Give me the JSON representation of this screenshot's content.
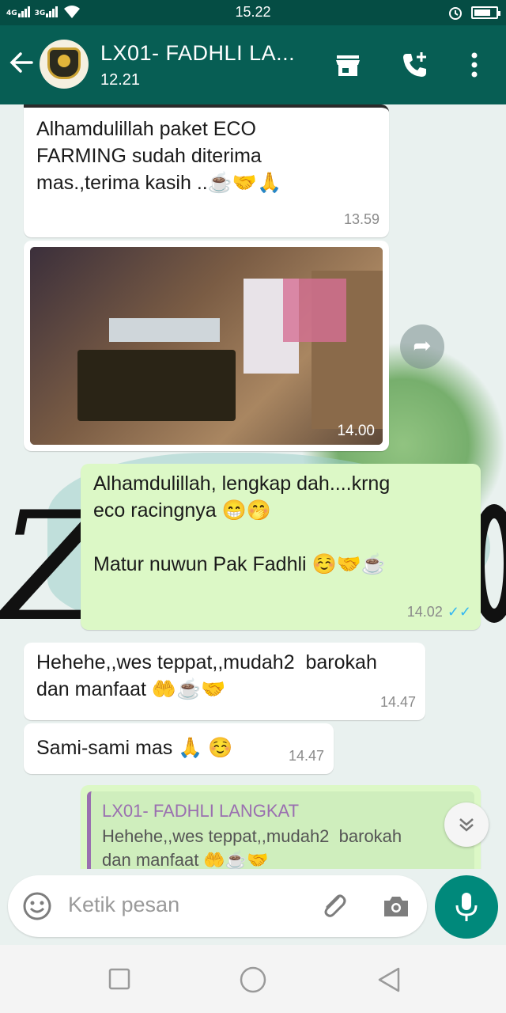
{
  "status_bar": {
    "time": "15.22",
    "network_left": "4G",
    "network_right": "3G",
    "icons": [
      "signal-icon",
      "wifi-icon",
      "alarm-icon",
      "battery-icon"
    ]
  },
  "header": {
    "contact_name": "LX01- FADHLI LA...",
    "last_seen": "12.21",
    "icons": [
      "back-arrow-icon",
      "store-icon",
      "add-call-icon",
      "more-vert-icon"
    ],
    "colors": {
      "bar": "#075e54",
      "status_bar": "#054d44"
    }
  },
  "messages": [
    {
      "id": "m1",
      "direction": "in",
      "text": "Alhamdulillah paket ECO\nFARMING sudah diterima\nmas.,terima kasih ..☕🤝🙏",
      "time": "13.59"
    },
    {
      "id": "m2",
      "direction": "in",
      "type": "photo",
      "time": "14.00"
    },
    {
      "id": "m3",
      "direction": "out",
      "text": "Alhamdulillah, lengkap dah....krng\neco racingnya 😁🤭\n\nMatur nuwun Pak Fadhli ☺️🤝☕",
      "time": "14.02",
      "read_ticks": "✓✓"
    },
    {
      "id": "m4",
      "direction": "in",
      "text": "Hehehe,,wes teppat,,mudah2  barokah\ndan manfaat 🤲☕🤝",
      "time": "14.47"
    },
    {
      "id": "m5",
      "direction": "in",
      "text": "Sami-sami mas 🙏 ☺️",
      "time": "14.47"
    },
    {
      "id": "m6",
      "direction": "out",
      "type": "reply",
      "quoted_name": "LX01- FADHLI LANGKAT",
      "quoted_text": "Hehehe,,wes teppat,,mudah2  barokah\ndan manfaat 🤲☕🤝"
    }
  ],
  "composer": {
    "placeholder": "Ketik pesan",
    "icons": [
      "emoji-icon",
      "attach-icon",
      "camera-icon",
      "mic-icon"
    ]
  },
  "colors": {
    "outgoing_bubble": "#dcf8c6",
    "incoming_bubble": "#ffffff",
    "accent": "#00897b",
    "read_ticks": "#34b7f1"
  }
}
